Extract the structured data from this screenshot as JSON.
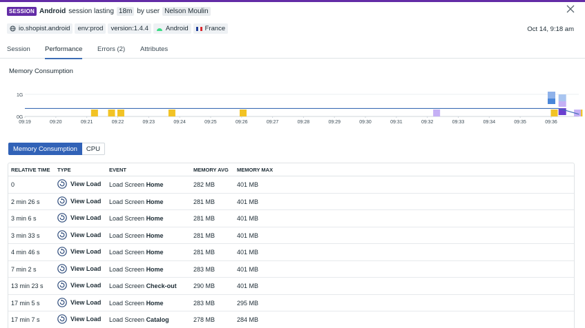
{
  "header": {
    "badge": "SESSION",
    "platform": "Android",
    "text1": "session lasting",
    "duration": "18m",
    "text2": "by user",
    "user": "Nelson Moulin"
  },
  "tags": {
    "app": "io.shopist.android",
    "env": "env:prod",
    "version": "version:1.4.4",
    "os": "Android",
    "country": "France"
  },
  "timestamp": "Oct 14, 9:18 am",
  "tabs": [
    {
      "label": "Session"
    },
    {
      "label": "Performance"
    },
    {
      "label": "Errors (2)"
    },
    {
      "label": "Attributes"
    }
  ],
  "section_title": "Memory Consumption",
  "toggle": {
    "on": "Memory Consumption",
    "off": "CPU"
  },
  "colors": {
    "accent": "#632ca6",
    "line": "#3d6db5",
    "view_marker": "#f2c325",
    "error_marker": "#c5b0f5"
  },
  "chart_data": {
    "type": "line",
    "y_tick_labels": [
      "1G",
      "0G"
    ],
    "x_tick_labels": [
      "09:19",
      "09:20",
      "09:21",
      "09:22",
      "09:23",
      "09:24",
      "09:25",
      "09:26",
      "09:27",
      "09:28",
      "09:29",
      "09:30",
      "09:31",
      "09:32",
      "09:33",
      "09:34",
      "09:35",
      "09:36"
    ],
    "ylim": [
      0,
      1.4
    ],
    "series": [
      {
        "x": [
          0,
          17.25,
          17.9
        ],
        "y": [
          0.36,
          0.36,
          0.1
        ]
      }
    ],
    "view_markers_at": [
      2.25,
      2.8,
      3.1,
      4.75,
      7.05,
      17.1,
      17.9
    ],
    "error_markers_at": [
      13.3,
      17.85
    ]
  },
  "table": {
    "headers": {
      "time": "RELATIVE TIME",
      "type": "TYPE",
      "event": "EVENT",
      "avg": "MEMORY AVG",
      "max": "MEMORY MAX"
    },
    "rows": [
      {
        "time": "0",
        "type": "View Load",
        "event_prefix": "Load Screen",
        "event_name": "Home",
        "avg": "282 MB",
        "max": "401 MB"
      },
      {
        "time": "2 min 26 s",
        "type": "View Load",
        "event_prefix": "Load Screen",
        "event_name": "Home",
        "avg": "281 MB",
        "max": "401 MB"
      },
      {
        "time": "3 min 6 s",
        "type": "View Load",
        "event_prefix": "Load Screen",
        "event_name": "Home",
        "avg": "281 MB",
        "max": "401 MB"
      },
      {
        "time": "3 min 33 s",
        "type": "View Load",
        "event_prefix": "Load Screen",
        "event_name": "Home",
        "avg": "281 MB",
        "max": "401 MB"
      },
      {
        "time": "4 min 46 s",
        "type": "View Load",
        "event_prefix": "Load Screen",
        "event_name": "Home",
        "avg": "281 MB",
        "max": "401 MB"
      },
      {
        "time": "7 min 2 s",
        "type": "View Load",
        "event_prefix": "Load Screen",
        "event_name": "Home",
        "avg": "283 MB",
        "max": "401 MB"
      },
      {
        "time": "13 min 23 s",
        "type": "View Load",
        "event_prefix": "Load Screen",
        "event_name": "Check-out",
        "avg": "290 MB",
        "max": "401 MB"
      },
      {
        "time": "17 min 5 s",
        "type": "View Load",
        "event_prefix": "Load Screen",
        "event_name": "Home",
        "avg": "283 MB",
        "max": "295 MB"
      },
      {
        "time": "17 min 7 s",
        "type": "View Load",
        "event_prefix": "Load Screen",
        "event_name": "Catalog",
        "avg": "278 MB",
        "max": "284 MB"
      }
    ]
  }
}
